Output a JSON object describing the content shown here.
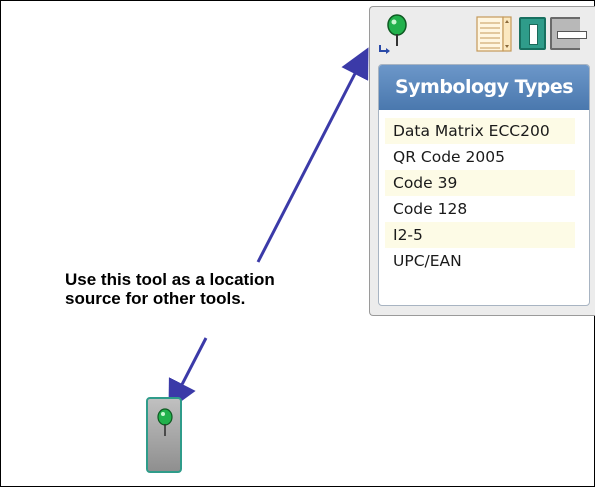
{
  "callout": {
    "line1": "Use this tool as a location",
    "line2": "source for other tools."
  },
  "toolbar": {
    "locator_icon": "location-pin-icon",
    "list_icon": "list-view-icon",
    "single_icon": "single-result-icon",
    "collapse_icon": "minus-icon"
  },
  "symbology": {
    "header": "Symbology Types",
    "items": [
      "Data Matrix ECC200",
      "QR Code 2005",
      "Code 39",
      "Code 128",
      "I2-5",
      "UPC/EAN"
    ]
  },
  "colors": {
    "arrow": "#3b3aa8",
    "pin": "#22b14c",
    "header": "#5a86bb",
    "accent": "#2f9c8a"
  }
}
